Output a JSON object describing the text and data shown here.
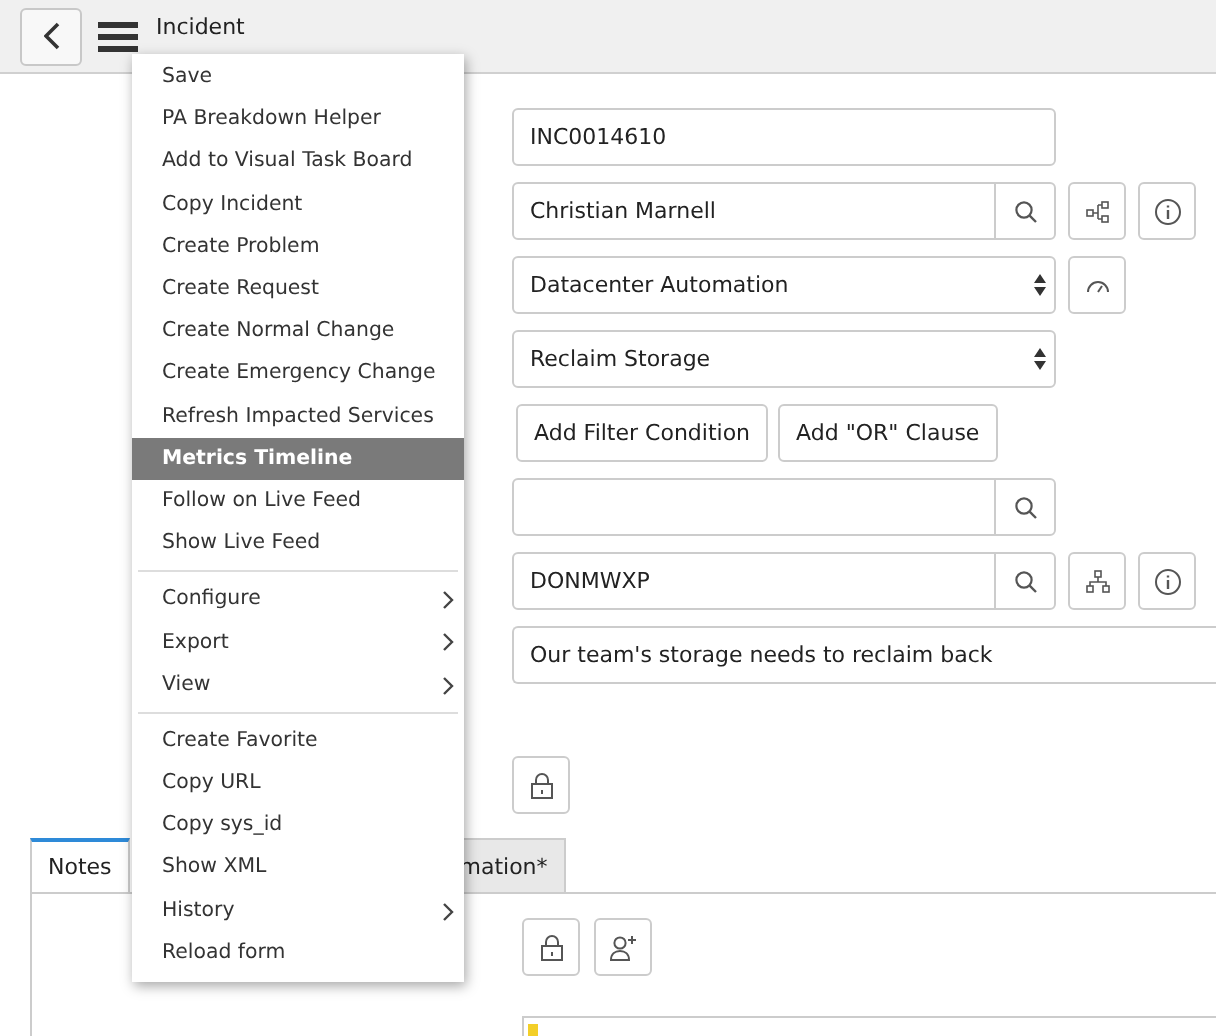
{
  "header": {
    "title": "Incident"
  },
  "menu": {
    "groups": [
      {
        "items": [
          {
            "label": "Save",
            "selected": false,
            "submenu": false
          },
          {
            "label": "PA Breakdown Helper",
            "selected": false,
            "submenu": false
          },
          {
            "label": "Add to Visual Task Board",
            "selected": false,
            "submenu": false
          },
          {
            "label": "Copy Incident",
            "selected": false,
            "submenu": false
          },
          {
            "label": "Create Problem",
            "selected": false,
            "submenu": false
          },
          {
            "label": "Create Request",
            "selected": false,
            "submenu": false
          },
          {
            "label": "Create Normal Change",
            "selected": false,
            "submenu": false
          },
          {
            "label": "Create Emergency Change",
            "selected": false,
            "submenu": false
          },
          {
            "label": "Refresh Impacted Services",
            "selected": false,
            "submenu": false
          },
          {
            "label": "Metrics Timeline",
            "selected": true,
            "submenu": false
          },
          {
            "label": "Follow on Live Feed",
            "selected": false,
            "submenu": false
          },
          {
            "label": "Show Live Feed",
            "selected": false,
            "submenu": false
          }
        ]
      },
      {
        "items": [
          {
            "label": "Configure",
            "selected": false,
            "submenu": true
          },
          {
            "label": "Export",
            "selected": false,
            "submenu": true
          },
          {
            "label": "View",
            "selected": false,
            "submenu": true
          }
        ]
      },
      {
        "items": [
          {
            "label": "Create Favorite",
            "selected": false,
            "submenu": false
          },
          {
            "label": "Copy URL",
            "selected": false,
            "submenu": false
          },
          {
            "label": "Copy sys_id",
            "selected": false,
            "submenu": false
          },
          {
            "label": "Show XML",
            "selected": false,
            "submenu": false
          },
          {
            "label": "History",
            "selected": false,
            "submenu": true
          },
          {
            "label": "Reload form",
            "selected": false,
            "submenu": false
          }
        ]
      }
    ]
  },
  "form": {
    "rows": [
      {
        "kind": "text",
        "value": "INC0014610"
      },
      {
        "kind": "reference",
        "value": "Christian Marnell",
        "extras": [
          {
            "kind": "tree"
          },
          {
            "kind": "info"
          }
        ]
      },
      {
        "kind": "select",
        "value": "Datacenter Automation",
        "extras": [
          {
            "kind": "gauge"
          }
        ]
      },
      {
        "kind": "select",
        "value": "Reclaim Storage"
      },
      {
        "kind": "buttons",
        "buttons": [
          "Add Filter Condition",
          "Add \"OR\" Clause"
        ]
      },
      {
        "kind": "reference",
        "value": ""
      },
      {
        "kind": "reference",
        "value": "DONMWXP",
        "extras": [
          {
            "kind": "hierarchy"
          },
          {
            "kind": "info"
          }
        ]
      },
      {
        "kind": "wide",
        "value": "Our team's storage needs to reclaim back"
      },
      {
        "kind": "spacer"
      },
      {
        "kind": "lock"
      }
    ]
  },
  "tabs": [
    {
      "label": "Notes",
      "selected": true
    },
    {
      "label": "mation*",
      "selected": false
    }
  ]
}
